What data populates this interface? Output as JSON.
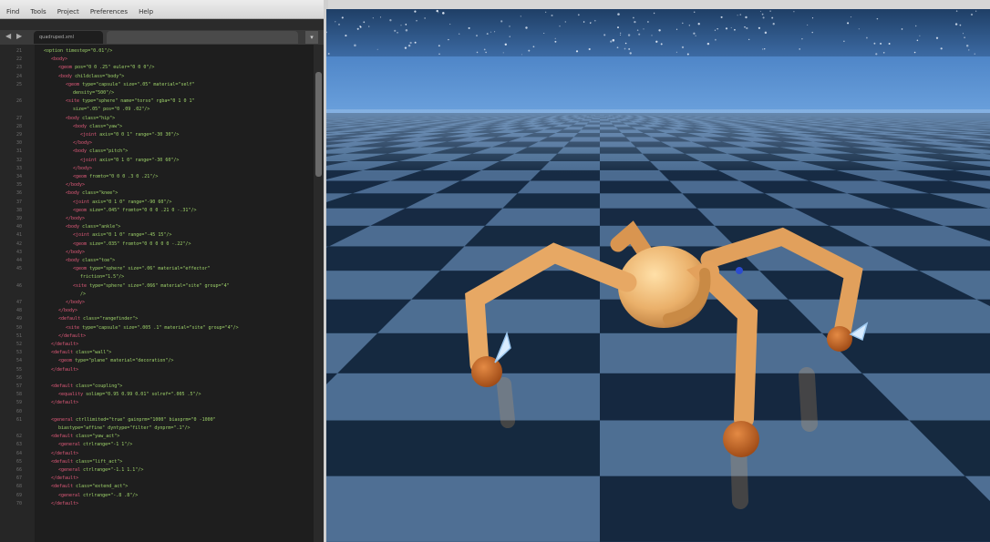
{
  "editor": {
    "menu": [
      "Find",
      "Tools",
      "Project",
      "Preferences",
      "Help"
    ],
    "tabs": [
      {
        "label": "quadruped.xml"
      },
      {
        "label": ""
      }
    ],
    "code_lines": [
      {
        "n": "21",
        "indent": 0,
        "tag": "",
        "text": "    <option timestep=\"0.01\"/>"
      },
      {
        "n": "22",
        "indent": 1,
        "tag": "<body>",
        "text": ""
      },
      {
        "n": "23",
        "indent": 2,
        "tag": "<geom",
        "text": " pos=\"0 0 .25\" euler=\"0 0 0\"/>"
      },
      {
        "n": "24",
        "indent": 2,
        "tag": "<body",
        "text": " childclass=\"body\">"
      },
      {
        "n": "25",
        "indent": 3,
        "tag": "<geom",
        "text": " type=\"capsule\" size=\".05\" material=\"self\""
      },
      {
        "n": "",
        "indent": 4,
        "tag": "",
        "text": "density=\"500\"/>"
      },
      {
        "n": "26",
        "indent": 3,
        "tag": "<site",
        "text": " type=\"sphere\" name=\"torso\" rgba=\"0 1 0 1\""
      },
      {
        "n": "",
        "indent": 4,
        "tag": "",
        "text": "size=\".05\" pos=\"0 .09 .02\"/>"
      },
      {
        "n": "27",
        "indent": 3,
        "tag": "<body",
        "text": " class=\"hip\">"
      },
      {
        "n": "28",
        "indent": 4,
        "tag": "<body",
        "text": " class=\"yaw\">"
      },
      {
        "n": "29",
        "indent": 5,
        "tag": "<joint",
        "text": " axis=\"0 0 1\" range=\"-30 30\"/>"
      },
      {
        "n": "30",
        "indent": 4,
        "tag": "</body>",
        "text": ""
      },
      {
        "n": "31",
        "indent": 4,
        "tag": "<body",
        "text": " class=\"pitch\">"
      },
      {
        "n": "32",
        "indent": 5,
        "tag": "<joint",
        "text": " axis=\"0 1 0\" range=\"-30 60\"/>"
      },
      {
        "n": "33",
        "indent": 4,
        "tag": "</body>",
        "text": ""
      },
      {
        "n": "34",
        "indent": 4,
        "tag": "<geom",
        "text": " fromto=\"0 0 0 .3 0 .21\"/>"
      },
      {
        "n": "35",
        "indent": 3,
        "tag": "</body>",
        "text": ""
      },
      {
        "n": "36",
        "indent": 3,
        "tag": "<body",
        "text": " class=\"knee\">"
      },
      {
        "n": "37",
        "indent": 4,
        "tag": "<joint",
        "text": " axis=\"0 1 0\" range=\"-90 60\"/>"
      },
      {
        "n": "38",
        "indent": 4,
        "tag": "<geom",
        "text": " size=\".045\" fromto=\"0 0 0 .21 0 -.31\"/>"
      },
      {
        "n": "39",
        "indent": 3,
        "tag": "</body>",
        "text": ""
      },
      {
        "n": "40",
        "indent": 3,
        "tag": "<body",
        "text": " class=\"ankle\">"
      },
      {
        "n": "41",
        "indent": 4,
        "tag": "<joint",
        "text": " axis=\"0 1 0\" range=\"-45 15\"/>"
      },
      {
        "n": "42",
        "indent": 4,
        "tag": "<geom",
        "text": " size=\".035\" fromto=\"0 0 0 0 0 -.22\"/>"
      },
      {
        "n": "43",
        "indent": 3,
        "tag": "</body>",
        "text": ""
      },
      {
        "n": "44",
        "indent": 3,
        "tag": "<body",
        "text": " class=\"toe\">"
      },
      {
        "n": "45",
        "indent": 4,
        "tag": "<geom",
        "text": " type=\"sphere\" size=\".06\" material=\"effector\""
      },
      {
        "n": "",
        "indent": 5,
        "tag": "",
        "text": "friction=\"1.5\"/>"
      },
      {
        "n": "46",
        "indent": 4,
        "tag": "<site",
        "text": " type=\"sphere\" size=\".066\" material=\"site\" group=\"4\""
      },
      {
        "n": "",
        "indent": 5,
        "tag": "",
        "text": "/>"
      },
      {
        "n": "47",
        "indent": 3,
        "tag": "</body>",
        "text": ""
      },
      {
        "n": "48",
        "indent": 2,
        "tag": "</body>",
        "text": ""
      },
      {
        "n": "49",
        "indent": 2,
        "tag": "<default",
        "text": " class=\"rangefinder\">"
      },
      {
        "n": "50",
        "indent": 3,
        "tag": "<site",
        "text": " type=\"capsule\" size=\".005 .1\" material=\"site\" group=\"4\"/>"
      },
      {
        "n": "51",
        "indent": 2,
        "tag": "</default>",
        "text": ""
      },
      {
        "n": "52",
        "indent": 1,
        "tag": "</default>",
        "text": ""
      },
      {
        "n": "53",
        "indent": 1,
        "tag": "<default",
        "text": " class=\"wall\">"
      },
      {
        "n": "54",
        "indent": 2,
        "tag": "<geom",
        "text": " type=\"plane\" material=\"decoration\"/>"
      },
      {
        "n": "55",
        "indent": 1,
        "tag": "</default>",
        "text": ""
      },
      {
        "n": "56",
        "indent": 0,
        "tag": "",
        "text": ""
      },
      {
        "n": "57",
        "indent": 1,
        "tag": "<default",
        "text": " class=\"coupling\">"
      },
      {
        "n": "58",
        "indent": 2,
        "tag": "<equality",
        "text": " solimp=\"0.95 0.99 0.01\" solref=\".005 .5\"/>"
      },
      {
        "n": "59",
        "indent": 1,
        "tag": "</default>",
        "text": ""
      },
      {
        "n": "60",
        "indent": 0,
        "tag": "",
        "text": ""
      },
      {
        "n": "61",
        "indent": 1,
        "tag": "<general",
        "text": " ctrllimited=\"true\" gainprm=\"1000\" biasprm=\"0 -1000\""
      },
      {
        "n": "",
        "indent": 2,
        "tag": "",
        "text": "biastype=\"affine\" dyntype=\"filter\" dynprm=\".1\"/>"
      },
      {
        "n": "62",
        "indent": 1,
        "tag": "<default",
        "text": " class=\"yaw_act\">"
      },
      {
        "n": "63",
        "indent": 2,
        "tag": "<general",
        "text": " ctrlrange=\"-1 1\"/>"
      },
      {
        "n": "64",
        "indent": 1,
        "tag": "</default>",
        "text": ""
      },
      {
        "n": "65",
        "indent": 1,
        "tag": "<default",
        "text": " class=\"lift_act\">"
      },
      {
        "n": "66",
        "indent": 2,
        "tag": "<general",
        "text": " ctrlrange=\"-1.1 1.1\"/>"
      },
      {
        "n": "67",
        "indent": 1,
        "tag": "</default>",
        "text": ""
      },
      {
        "n": "68",
        "indent": 1,
        "tag": "<default",
        "text": " class=\"extend_act\">"
      },
      {
        "n": "69",
        "indent": 2,
        "tag": "<general",
        "text": " ctrlrange=\"-.8 .8\"/>"
      },
      {
        "n": "70",
        "indent": 1,
        "tag": "</default>",
        "text": ""
      }
    ]
  },
  "viewer": {
    "colors": {
      "sky": "#2c5c93",
      "horizon": "#5a8fd0",
      "floor_light": "#4f6f94",
      "floor_dark": "#15283f",
      "body": "#e9a85c",
      "foot": "#c2601f"
    }
  }
}
